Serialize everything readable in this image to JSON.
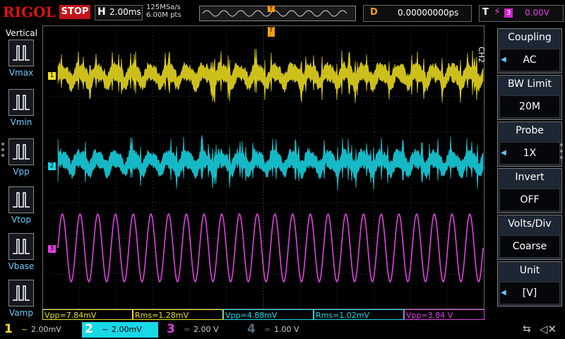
{
  "header": {
    "brand": "RIGOL",
    "run_state": "STOP",
    "timebase_label": "H",
    "timebase_value": "2.00ms",
    "sample_rate": "125MSa/s",
    "memory_depth": "6.00M pts",
    "trigger_marker": "T",
    "delay_label": "D",
    "delay_value": "0.00000000ps",
    "trigger_label": "T",
    "trigger_source": "3",
    "trigger_level": "0.00V"
  },
  "left_panel": {
    "title": "Vertical",
    "items": [
      {
        "label": "Vmax",
        "icon": "vmax-icon"
      },
      {
        "label": "Vmin",
        "icon": "vmin-icon"
      },
      {
        "label": "Vpp",
        "icon": "vpp-icon"
      },
      {
        "label": "Vtop",
        "icon": "vtop-icon"
      },
      {
        "label": "Vbase",
        "icon": "vbase-icon"
      },
      {
        "label": "Vamp",
        "icon": "vamp-icon"
      }
    ]
  },
  "right_menu": {
    "channel": "CH2",
    "items": [
      {
        "title": "Coupling",
        "value": "AC",
        "arrow": true
      },
      {
        "title": "BW Limit",
        "value": "20M",
        "arrow": false
      },
      {
        "title": "Probe",
        "value": "1X",
        "arrow": true
      },
      {
        "title": "Invert",
        "value": "OFF",
        "arrow": false
      },
      {
        "title": "Volts/Div",
        "value": "Coarse",
        "arrow": false
      },
      {
        "title": "Unit",
        "value": "[V]",
        "arrow": true
      }
    ]
  },
  "channel_markers": {
    "ch1": "1",
    "ch2": "2",
    "ch3": "3"
  },
  "measurements": [
    {
      "text": "Vpp=7.84mV",
      "color": "#e8e020"
    },
    {
      "text": "Rms=1.28mV",
      "color": "#e8e020"
    },
    {
      "text": "Vpp=4.88mV",
      "color": "#19d8e8"
    },
    {
      "text": "Rms=1.02mV",
      "color": "#19d8e8"
    },
    {
      "text": "Vpp=3.84 V",
      "color": "#e040e0"
    }
  ],
  "channels": [
    {
      "num": "1",
      "coupling": "~",
      "scale": "2.00mV",
      "color": "#f0e020",
      "active": true
    },
    {
      "num": "2",
      "coupling": "~",
      "scale": "2.00mV",
      "color": "#19d8e8",
      "active": true
    },
    {
      "num": "3",
      "coupling": "=",
      "scale": "2.00 V",
      "color": "#e040e0",
      "active": false
    },
    {
      "num": "4",
      "coupling": "=",
      "scale": "1.00 V",
      "color": "#5a6a7a",
      "active": false
    }
  ],
  "colors": {
    "ch1": "#f0e020",
    "ch2": "#19d8e8",
    "ch3": "#e040e0",
    "trigger": "#f39c12",
    "brand": "#d11"
  }
}
